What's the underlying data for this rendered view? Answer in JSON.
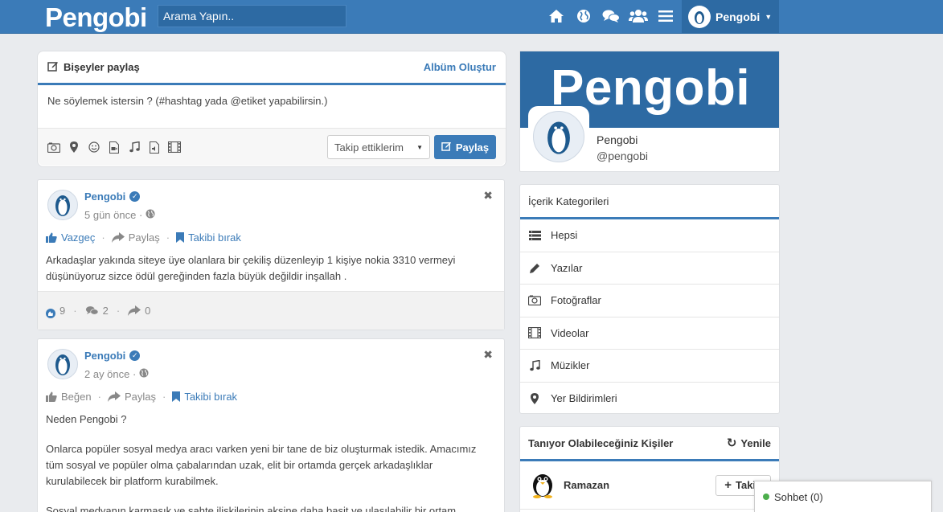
{
  "topbar": {
    "logo": "Pengobi",
    "search_placeholder": "Arama Yapın..",
    "nav_icons": [
      "home-icon",
      "globe-icon",
      "comments-icon",
      "users-icon",
      "menu-icon"
    ],
    "user_name": "Pengobi"
  },
  "share": {
    "title": "Bişeyler paylaş",
    "album_link": "Albüm Oluştur",
    "placeholder": "Ne söylemek istersin ? (#hashtag yada @etiket yapabilirsin.)",
    "tools": [
      "camera-icon",
      "location-icon",
      "smile-icon",
      "video-file-icon",
      "music-icon",
      "audio-file-icon",
      "film-icon"
    ],
    "audience": "Takip ettiklerim",
    "submit": "Paylaş"
  },
  "posts": [
    {
      "author": "Pengobi",
      "time": "5 gün önce ·",
      "like_label": "Vazgeç",
      "share_label": "Paylaş",
      "follow_label": "Takibi bırak",
      "body": "Arkadaşlar yakında siteye üye olanlara bir çekiliş düzenleyip 1 kişiye nokia 3310 vermeyi düşünüyoruz sizce ödül gereğinden fazla büyük değildir inşallah .",
      "likes": "9",
      "comments": "2",
      "shares": "0"
    },
    {
      "author": "Pengobi",
      "time": "2 ay önce ·",
      "like_label": "Beğen",
      "share_label": "Paylaş",
      "follow_label": "Takibi bırak",
      "body_p1": "Neden Pengobi ?",
      "body_p2": "Onlarca popüler sosyal medya aracı varken yeni bir tane de biz oluşturmak istedik. Amacımız tüm sosyal ve popüler olma çabalarından uzak, elit bir ortamda gerçek arkadaşlıklar kurulabilecek bir platform kurabilmek.",
      "body_p3": "Sosyal medyanın karmaşık ve sahte ilişkilerinin aksine daha basit ve ulaşılabilir bir ortam"
    }
  ],
  "profile": {
    "cover_text": "Pengobi",
    "name": "Pengobi",
    "handle": "@pengobi"
  },
  "categories": {
    "title": "İçerik Kategorileri",
    "items": [
      {
        "label": "Hepsi",
        "icon": "list-icon"
      },
      {
        "label": "Yazılar",
        "icon": "pencil-icon"
      },
      {
        "label": "Fotoğraflar",
        "icon": "camera-icon"
      },
      {
        "label": "Videolar",
        "icon": "film-icon"
      },
      {
        "label": "Müzikler",
        "icon": "music-icon"
      },
      {
        "label": "Yer Bildirimleri",
        "icon": "location-icon"
      }
    ]
  },
  "people": {
    "title": "Tanıyor Olabileceğiniz Kişiler",
    "refresh": "Yenile",
    "items": [
      {
        "name": "Ramazan",
        "follow": "Takip"
      }
    ]
  },
  "chat": {
    "label": "Sohbet (0)"
  },
  "colors": {
    "brand": "#3b7bb8",
    "brand_dark": "#2d6aa3",
    "online": "#4cae4c"
  }
}
